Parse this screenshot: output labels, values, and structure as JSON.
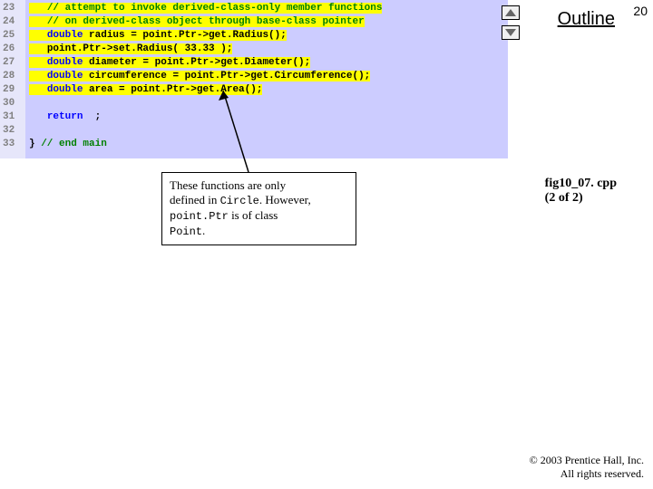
{
  "page_number": "20",
  "outline_label": "Outline",
  "line_numbers": [
    "23",
    "24",
    "25",
    "26",
    "27",
    "28",
    "29",
    "30",
    "31",
    "32",
    "33"
  ],
  "code": {
    "l23": {
      "indent": "   ",
      "text": "// attempt to invoke derived-class-only member functions"
    },
    "l24": {
      "indent": "   ",
      "text": "// on derived-class object through base-class pointer"
    },
    "l25": {
      "indent": "   ",
      "kw": "double",
      "rest": " radius = point.Ptr->get.Radius();"
    },
    "l26": {
      "indent": "   ",
      "rest": "point.Ptr->set.Radius( 33.33 );"
    },
    "l27": {
      "indent": "   ",
      "kw": "double",
      "rest": " diameter = point.Ptr->get.Diameter();"
    },
    "l28": {
      "indent": "   ",
      "kw": "double",
      "rest": " circumference = point.Ptr->get.Circumference();"
    },
    "l29": {
      "indent": "   ",
      "kw": "double",
      "rest": " area = point.Ptr->get.Area();"
    },
    "l30": {
      "indent": "",
      "rest": ""
    },
    "l31": {
      "indent": "   ",
      "kw": "return",
      "rest": "  ;"
    },
    "l32": {
      "indent": "",
      "rest": ""
    },
    "l33": {
      "brace": "} ",
      "text": "// end main"
    }
  },
  "annotation": {
    "line1": "These functions are only",
    "line2a": "defined in ",
    "line2b": "Circle",
    "line2c": ". However,",
    "line3a": "point.Ptr",
    "line3b": " is of class",
    "line4": "Point",
    "line4b": "."
  },
  "filename": {
    "name": "fig10_07. cpp",
    "part": "(2 of 2)"
  },
  "copyright": {
    "l1": "© 2003 Prentice Hall, Inc.",
    "l2": "All rights reserved."
  }
}
